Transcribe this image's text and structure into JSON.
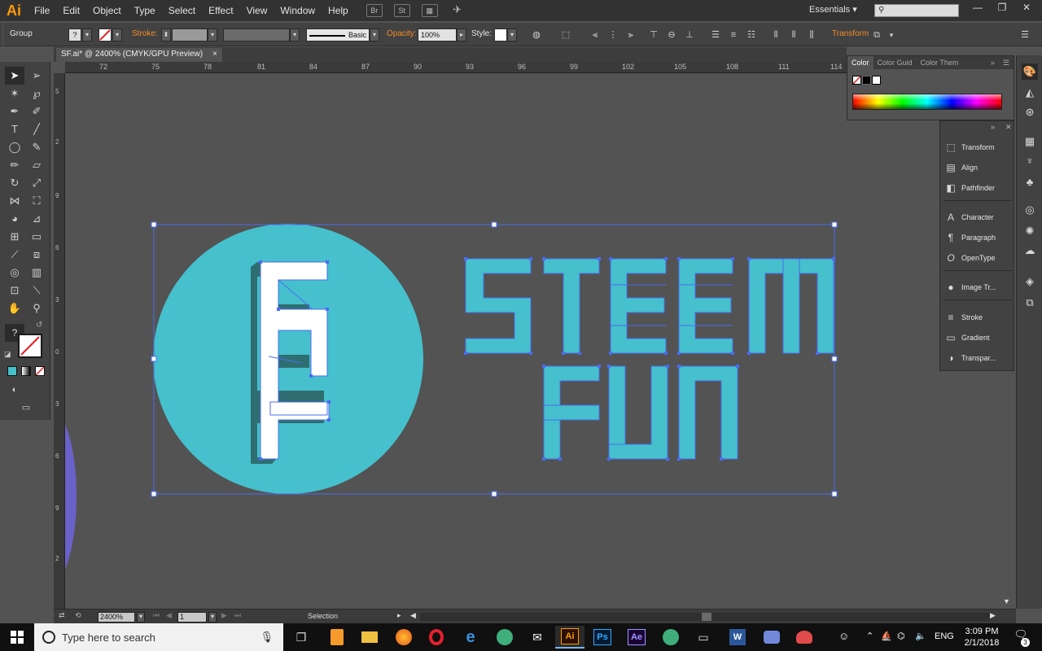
{
  "app": {
    "logo": "Ai",
    "workspace": "Essentials",
    "search_placeholder": ""
  },
  "menu": [
    "File",
    "Edit",
    "Object",
    "Type",
    "Select",
    "Effect",
    "View",
    "Window",
    "Help"
  ],
  "menubar_icons": {
    "bridge": "Br",
    "stock": "St"
  },
  "window_controls": {
    "minimize": "—",
    "restore": "❐",
    "close": "✕"
  },
  "control_bar": {
    "selection_type": "Group",
    "fill_value": "?",
    "stroke_label": "Stroke:",
    "stroke_style": "Basic",
    "opacity_label": "Opacity:",
    "opacity_value": "100%",
    "style_label": "Style:",
    "transform_label": "Transform"
  },
  "document": {
    "tab_title": "SF.ai* @ 2400% (CMYK/GPU Preview)",
    "close": "×"
  },
  "ruler_top": [
    "72",
    "75",
    "78",
    "81",
    "84",
    "87",
    "90",
    "93",
    "96",
    "99",
    "102",
    "105",
    "108",
    "111",
    "114"
  ],
  "ruler_left": [
    "5",
    "2",
    "9",
    "6",
    "3",
    "0",
    "3",
    "6",
    "9",
    "2"
  ],
  "artwork": {
    "word1": "STEEM",
    "word2": "FUN",
    "monogram": "SF",
    "circle_color": "#45c0cc",
    "text_color": "#45c0cc",
    "shadow_color": "#2f6e70",
    "selection_color": "#4a6cf0"
  },
  "color_panel": {
    "tabs": [
      "Color",
      "Color Guid",
      "Color Them"
    ]
  },
  "panels": [
    {
      "label": "Transform",
      "icon": "transform-icon"
    },
    {
      "label": "Align",
      "icon": "align-icon"
    },
    {
      "label": "Pathfinder",
      "icon": "pathfinder-icon"
    },
    {
      "label": "Character",
      "icon": "character-icon"
    },
    {
      "label": "Paragraph",
      "icon": "paragraph-icon"
    },
    {
      "label": "OpenType",
      "icon": "opentype-icon"
    },
    {
      "label": "Image Tr...",
      "icon": "image-trace-icon"
    },
    {
      "label": "Stroke",
      "icon": "stroke-icon"
    },
    {
      "label": "Gradient",
      "icon": "gradient-icon"
    },
    {
      "label": "Transpar...",
      "icon": "transparency-icon"
    }
  ],
  "status_bar": {
    "zoom": "2400%",
    "page": "1",
    "tool": "Selection"
  },
  "taskbar": {
    "search_text": "Type here to search",
    "language": "ENG",
    "time": "3:09 PM",
    "date": "2/1/2018",
    "notification_count": "3"
  }
}
